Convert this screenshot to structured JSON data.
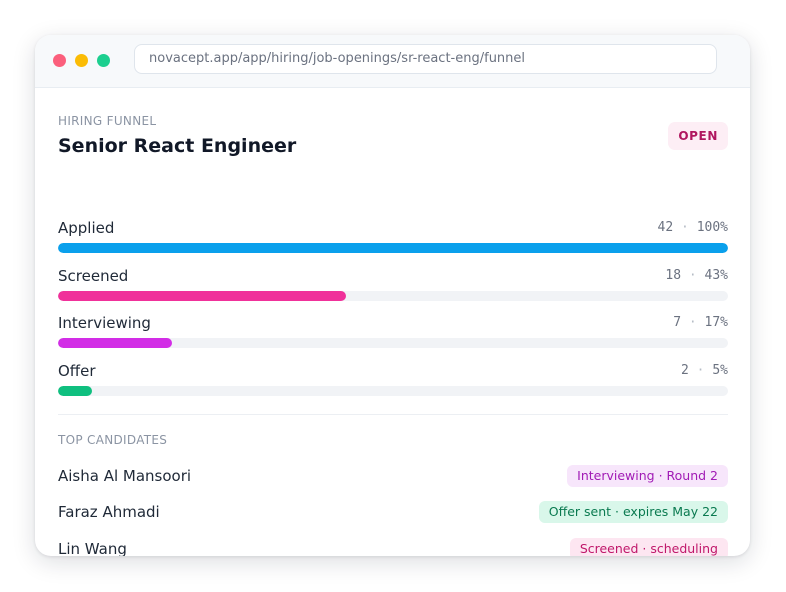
{
  "browser": {
    "url": "novacept.app/app/hiring/job-openings/sr-react-eng/funnel"
  },
  "header": {
    "eyebrow": "HIRING FUNNEL",
    "job_title": "Senior React Engineer",
    "status": "OPEN"
  },
  "funnel": {
    "stages": [
      {
        "label": "Applied",
        "count": "42",
        "percent": "100%",
        "fill_fraction": 1.0,
        "color": "#0aa0ec"
      },
      {
        "label": "Screened",
        "count": "18",
        "percent": "43%",
        "fill_fraction": 0.43,
        "color": "#f0319a"
      },
      {
        "label": "Interviewing",
        "count": "7",
        "percent": "17%",
        "fill_fraction": 0.17,
        "color": "#d22de6"
      },
      {
        "label": "Offer",
        "count": "2",
        "percent": "5%",
        "fill_fraction": 0.05,
        "color": "#0fbf7f"
      }
    ]
  },
  "candidates": {
    "title": "TOP CANDIDATES",
    "items": [
      {
        "name": "Aisha Al Mansoori",
        "status": "Interviewing · Round 2",
        "bg": "#f7e6fb",
        "fg": "#a11bb5"
      },
      {
        "name": "Faraz Ahmadi",
        "status": "Offer sent · expires May 22",
        "bg": "#d9f7ea",
        "fg": "#0a7a50"
      },
      {
        "name": "Lin Wang",
        "status": "Screened · scheduling",
        "bg": "#fde6f1",
        "fg": "#c0176a"
      }
    ]
  }
}
